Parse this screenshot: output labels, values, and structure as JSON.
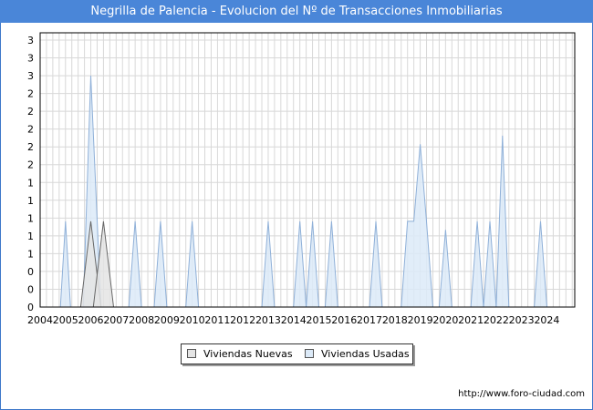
{
  "chart_data": {
    "type": "area",
    "title": "Negrilla de Palencia - Evolucion del Nº de Transacciones Inmobiliarias",
    "xlabel": "",
    "ylabel": "",
    "x_ticks": [
      "2004",
      "2005",
      "2006",
      "2007",
      "2008",
      "2009",
      "2010",
      "2011",
      "2012",
      "2013",
      "2014",
      "2015",
      "2016",
      "2017",
      "2018",
      "2019",
      "2020",
      "2021",
      "2022",
      "2023",
      "2024"
    ],
    "y_ticks": [
      "0",
      "0",
      "0",
      "1",
      "1",
      "1",
      "1",
      "1",
      "2",
      "2",
      "2",
      "2",
      "2",
      "3",
      "3",
      "3"
    ],
    "ylim": [
      0,
      3.2
    ],
    "xlim": [
      2004,
      2025.1
    ],
    "grid": true,
    "legend_position": "bottom-center",
    "colors": {
      "nuevas_fill": "#e4e4e4",
      "nuevas_line": "#666666",
      "usadas_fill": "#dceaf8",
      "usadas_line": "#8fb0d8",
      "grid": "#d8d8d8",
      "title_bar": "#4a86d8"
    },
    "series": [
      {
        "name": "Viviendas Nuevas",
        "points": [
          [
            2005.6,
            0
          ],
          [
            2006.0,
            1
          ],
          [
            2006.4,
            0
          ],
          [
            2006.1,
            0
          ],
          [
            2006.5,
            1
          ],
          [
            2006.9,
            0
          ]
        ]
      },
      {
        "name": "Viviendas Usadas",
        "points": [
          [
            2004.8,
            0
          ],
          [
            2005.0,
            1
          ],
          [
            2005.2,
            0
          ],
          [
            2005.7,
            0
          ],
          [
            2006.0,
            2.7
          ],
          [
            2006.4,
            0
          ],
          [
            2007.5,
            0
          ],
          [
            2007.75,
            1
          ],
          [
            2008.0,
            0
          ],
          [
            2008.5,
            0
          ],
          [
            2008.75,
            1
          ],
          [
            2009.0,
            0
          ],
          [
            2009.75,
            0
          ],
          [
            2010.0,
            1
          ],
          [
            2010.25,
            0
          ],
          [
            2012.75,
            0
          ],
          [
            2013.0,
            1
          ],
          [
            2013.25,
            0
          ],
          [
            2014.0,
            0
          ],
          [
            2014.25,
            1
          ],
          [
            2014.5,
            0
          ],
          [
            2014.5,
            0
          ],
          [
            2014.75,
            1
          ],
          [
            2015.0,
            0
          ],
          [
            2015.25,
            0
          ],
          [
            2015.5,
            1
          ],
          [
            2015.75,
            0
          ],
          [
            2017.0,
            0
          ],
          [
            2017.25,
            1
          ],
          [
            2017.5,
            0
          ],
          [
            2018.25,
            0
          ],
          [
            2018.5,
            1
          ],
          [
            2018.75,
            1
          ],
          [
            2019.0,
            1.9
          ],
          [
            2019.25,
            1
          ],
          [
            2019.5,
            0
          ],
          [
            2019.75,
            0
          ],
          [
            2020.0,
            0.9
          ],
          [
            2020.25,
            0
          ],
          [
            2021.0,
            0
          ],
          [
            2021.25,
            1
          ],
          [
            2021.5,
            0
          ],
          [
            2021.5,
            0
          ],
          [
            2021.75,
            1
          ],
          [
            2022.0,
            0
          ],
          [
            2022.0,
            0
          ],
          [
            2022.25,
            2
          ],
          [
            2022.5,
            0
          ],
          [
            2023.5,
            0
          ],
          [
            2023.75,
            1
          ],
          [
            2024.0,
            0
          ]
        ]
      }
    ]
  },
  "legend": {
    "nuevas_label": "Viviendas Nuevas",
    "usadas_label": "Viviendas Usadas"
  },
  "footer": {
    "url": "http://www.foro-ciudad.com"
  }
}
